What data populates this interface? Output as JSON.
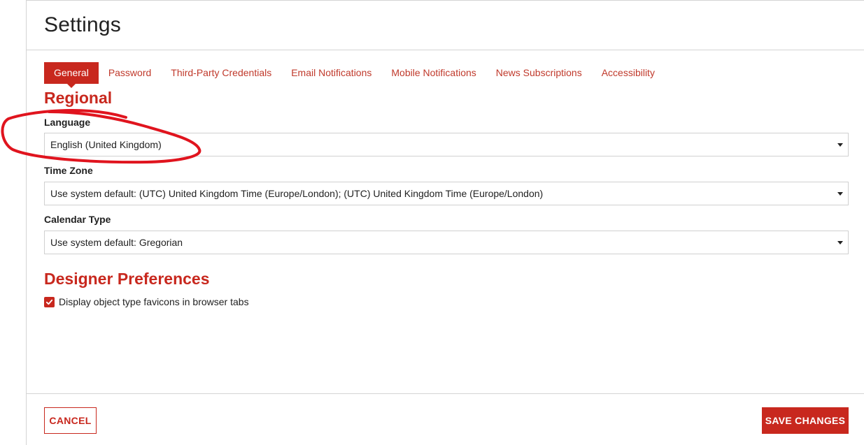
{
  "page": {
    "title": "Settings"
  },
  "tabs": [
    {
      "label": "General",
      "active": true
    },
    {
      "label": "Password",
      "active": false
    },
    {
      "label": "Third-Party Credentials",
      "active": false
    },
    {
      "label": "Email Notifications",
      "active": false
    },
    {
      "label": "Mobile Notifications",
      "active": false
    },
    {
      "label": "News Subscriptions",
      "active": false
    },
    {
      "label": "Accessibility",
      "active": false
    }
  ],
  "regional": {
    "heading": "Regional",
    "language": {
      "label": "Language",
      "value": "English (United Kingdom)"
    },
    "time_zone": {
      "label": "Time Zone",
      "value": "Use system default: (UTC) United Kingdom Time (Europe/London); (UTC) United Kingdom Time (Europe/London)"
    },
    "calendar_type": {
      "label": "Calendar Type",
      "value": "Use system default: Gregorian"
    }
  },
  "designer": {
    "heading": "Designer Preferences",
    "favicons": {
      "label": "Display object type favicons in browser tabs",
      "checked": true
    }
  },
  "footer": {
    "cancel_label": "CANCEL",
    "save_label": "SAVE CHANGES"
  },
  "colors": {
    "accent": "#c8281e",
    "annotation": "#e0141e"
  },
  "icons": {
    "dropdown": "caret-down-icon",
    "checkbox": "checkmark-icon"
  }
}
